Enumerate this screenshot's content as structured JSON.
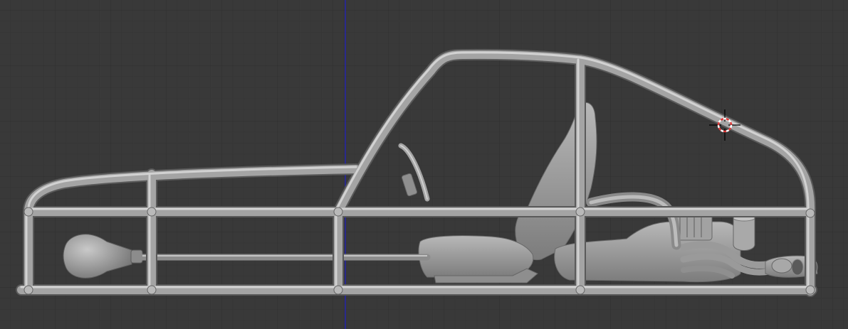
{
  "viewport": {
    "background": "#393939",
    "grid_line_color": "#2f2f2f",
    "grid_minor_color": "#363636",
    "z_axis_color": "#1f1fa0",
    "frame_color": "#a9a9a9",
    "frame_shade_color": "#6a6a6a",
    "object_color": "#9c9c9c",
    "cursor_ring_colors": [
      "#e23b3b",
      "#ffffff"
    ],
    "view_type": "orthographic side view",
    "shading": "solid"
  },
  "scene": {
    "object": "buggy-frame",
    "components": [
      "roll-cage",
      "seat",
      "steering-wheel",
      "engine",
      "exhaust",
      "fuel-tank",
      "drive-shaft"
    ]
  },
  "cursor": {
    "icon": "3d-cursor-icon"
  }
}
